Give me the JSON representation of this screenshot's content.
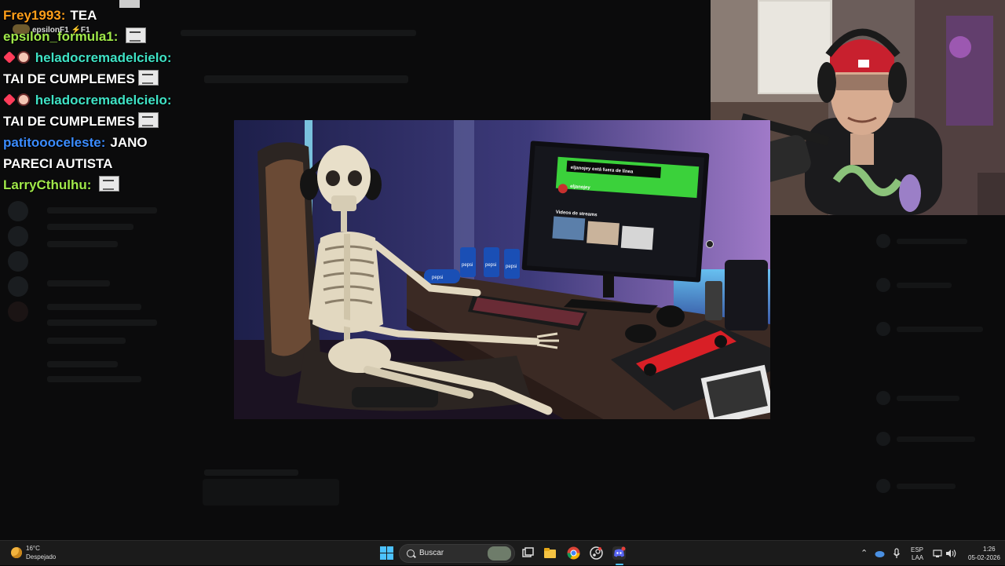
{
  "chat": {
    "messages": [
      {
        "user": "Frey1993:",
        "text": "TEA",
        "color": "#ff9f1a",
        "emote": false,
        "sub_tag": "epsilonF1 ⚡F1"
      },
      {
        "user": "epsilon_formula1:",
        "text": "",
        "color": "#a0e84a",
        "emote": true
      },
      {
        "user": "heladocremadelcielo:",
        "text": "",
        "color": "#3fe2c5",
        "emote": false,
        "badges": true
      },
      {
        "user": "",
        "text": "TAI DE CUMPLEMES",
        "color": "#ffffff",
        "emote": true
      },
      {
        "user": "heladocremadelcielo:",
        "text": "",
        "color": "#3fe2c5",
        "emote": false,
        "badges": true
      },
      {
        "user": "",
        "text": "TAI DE CUMPLEMES",
        "color": "#ffffff",
        "emote": true
      },
      {
        "user": "patitoooceleste:",
        "text": "JANO",
        "color": "#3b8cff",
        "emote": false
      },
      {
        "user": "",
        "text": "PARECI AUTISTA",
        "color": "#ffffff",
        "emote": false
      },
      {
        "user": "LarryCthulhu:",
        "text": "",
        "color": "#a0e84a",
        "emote": true
      }
    ]
  },
  "main_image": {
    "monitor_banner": "eljanojey está fuera de línea",
    "channel_name": "eljanojey",
    "section_title": "Videos de streams",
    "can_labels": [
      "pepsi",
      "pepsi",
      "pepsi",
      "pepsi"
    ]
  },
  "taskbar": {
    "weather_temp": "16°C",
    "weather_desc": "Despejado",
    "search_placeholder": "Buscar",
    "lang_top": "ESP",
    "lang_bottom": "LAA",
    "time": "1:26",
    "date": "05-02-2026",
    "accent": "#4cc2ff"
  }
}
